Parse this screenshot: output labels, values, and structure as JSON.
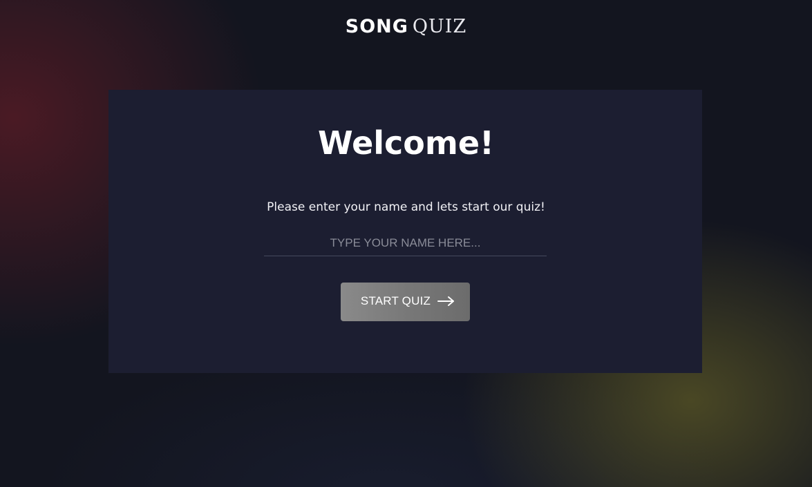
{
  "header": {
    "logo_bold": "SONG",
    "logo_light": "QUIZ"
  },
  "welcome": {
    "title": "Welcome!",
    "prompt": "Please enter your name and lets start our quiz!",
    "name_input": {
      "value": "",
      "placeholder": "TYPE YOUR NAME HERE..."
    },
    "start_button": {
      "label": "START QUIZ",
      "icon": "arrow-right-icon"
    }
  },
  "colors": {
    "background": "#13151f",
    "card": "#1c1e31",
    "text": "#ffffff",
    "button": "#7d7d7d"
  }
}
